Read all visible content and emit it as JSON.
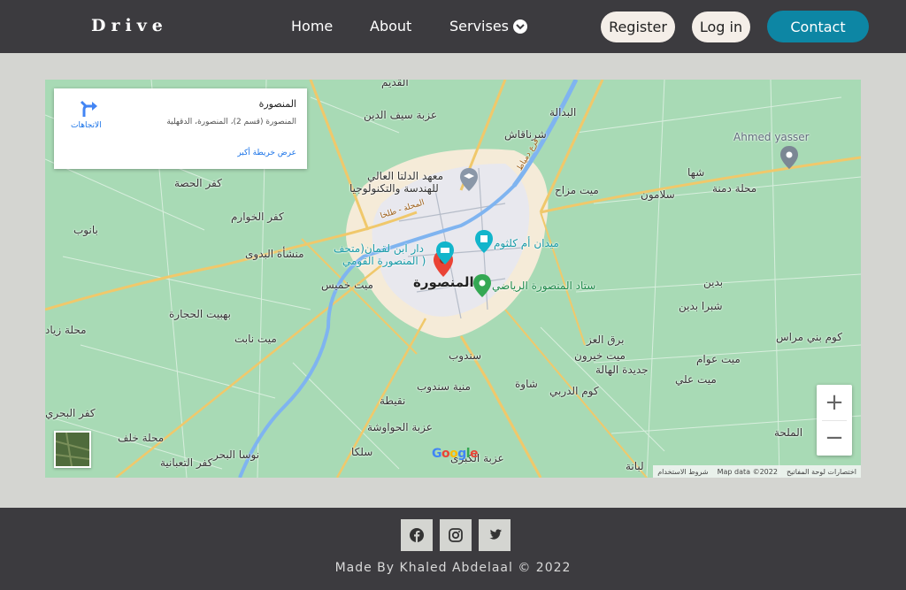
{
  "navbar": {
    "brand": "Drive",
    "links": {
      "home": "Home",
      "about": "About",
      "services": "Servises"
    },
    "register_label": "Register",
    "login_label": "Log in",
    "contact_label": "Contact",
    "colors": {
      "bar": "#3c3b3f",
      "contact": "#0d86a4",
      "pill": "#f4eee8"
    }
  },
  "map": {
    "info_card": {
      "title": "المنصورة",
      "address": "المنصورة (قسم 2)، المنصورة، الدقهلية",
      "larger_map_link": "عرض خريطة أكبر",
      "directions_label": "الاتجاهات"
    },
    "labels": {
      "mansoura": "المنصورة",
      "ahmed_yasser": "Ahmed yasser",
      "stadium": "ستاد المنصورة الرياضي",
      "umm_kulthum": "ميدان أم كلثوم",
      "dar_ibn_luqman": "دار ابن لقمان(متحف",
      "national_museum": "المنصورة القومي )",
      "higher_institute_1": "معهد الدلتا العالي",
      "higher_institute_2": "للهندسة والتكنولوجيا",
      "meet_khamis": "ميت خميس",
      "sherbeen": "شرناقاش",
      "sandoub": "سندوب",
      "meet_mazah": "ميت مزاح",
      "salamoun": "سلامون",
      "shaha": "شها",
      "mahallet_demna": "محلة دمنة",
      "kafr_el_hesa": "كفر الحصة",
      "kafr_el_khawaram": "كفر الخوارم",
      "banoub": "بانوب",
      "menshat_el_badawy": "منشأة البدوى",
      "bahbit": "بهبيت الحجارة",
      "meet_nabet": "ميت نابت",
      "mahallet_zayad": "محلة زياد",
      "badeen": "بدين",
      "shubra_badeen": "شبرا بدين",
      "kom_bani_murras": "كوم بني مراس",
      "barq_el_ezz": "برق العز",
      "meet_khayron": "ميت خيرون",
      "gedeedet_el_hala": "جديدة الهالة",
      "meet_awam": "ميت عوام",
      "meet_ali": "ميت علي",
      "kom_el_derby": "كوم الدربي",
      "shawa": "شاوة",
      "meniet_sandoub": "منية سندوب",
      "nakita": "نقيطة",
      "ezbet_el_hawawsha": "عزبة الحواوشة",
      "selka": "سلكا",
      "mahallet_khalaf": "محلة خلف",
      "nawasa_el_bahr": "نوسا البحر",
      "kafr_el_bahry": "كفر البحري",
      "el_baddala": "البدالة",
      "ezbet_seif_el_din": "عزبة سيف الدين",
      "el_qadeem": "القديم",
      "el_malha": "الملحة",
      "lebana": "لبانة",
      "ezbet_kebra": "عزبة الكبرى",
      "kafr_el_kom": "كفر التعبانية",
      "dakahlia_road": "المحلة - طلخا",
      "bahr_label": "فرع دمياط"
    },
    "attribution": {
      "keyboard": "اختصارات لوحة المفاتيح",
      "map_data": "Map data ©2022",
      "terms": "شروط الاستخدام"
    },
    "google_logo": "Google",
    "zoom_in_label": "+",
    "zoom_out_label": "−"
  },
  "footer": {
    "social": [
      "facebook-icon",
      "instagram-icon",
      "twitter-icon"
    ],
    "copyright": "Made By Khaled Abdelaal © 2022"
  }
}
